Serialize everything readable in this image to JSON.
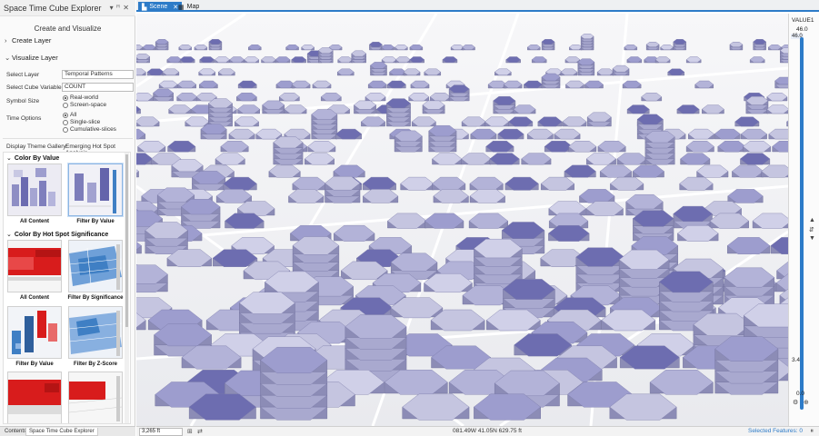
{
  "pane": {
    "title": "Space Time Cube Explorer",
    "subtitle": "Create and Visualize",
    "create_layer": "Create Layer",
    "visualize_layer": "Visualize Layer",
    "select_layer_label": "Select Layer",
    "select_layer_value": "Temporal Patterns",
    "cube_variable_label": "Select Cube Variable",
    "cube_variable_value": "COUNT",
    "symbol_size_label": "Symbol Size",
    "symbol_size_options": [
      "Real-world",
      "Screen-space"
    ],
    "time_options_label": "Time Options",
    "time_options": [
      "All",
      "Single-slice",
      "Cumulative-slices"
    ],
    "gallery_label": "Display Theme Gallery:",
    "gallery_value": "Emerging Hot Spot Analysis",
    "groups": [
      {
        "title": "Color By Value",
        "items": [
          "All Content",
          "Filter By Value"
        ]
      },
      {
        "title": "Color By Hot Spot Significance",
        "items": [
          "All Content",
          "Filter By Significance",
          "Filter By Value",
          "Filter By Z-Score"
        ]
      }
    ],
    "tabs": [
      "Contents",
      "Space Time Cube Explorer"
    ]
  },
  "view_tabs": [
    "Scene",
    "Map"
  ],
  "legend": {
    "title": "VALUE1",
    "max": "46.0",
    "current": "46.0",
    "low": "3.4",
    "min": "0.0"
  },
  "status": {
    "scale": "3,265 ft",
    "coords": "081.49W 41.05N  629.75 ft",
    "selected": "Selected Features: 0"
  },
  "colors": {
    "accent": "#2d7bc8",
    "hex_light": "#c5c5e0",
    "hex_mid": "#9d9dce",
    "hex_dark": "#6d6db0",
    "hot": "#d81c1c",
    "cold": "#3f7fc4"
  }
}
